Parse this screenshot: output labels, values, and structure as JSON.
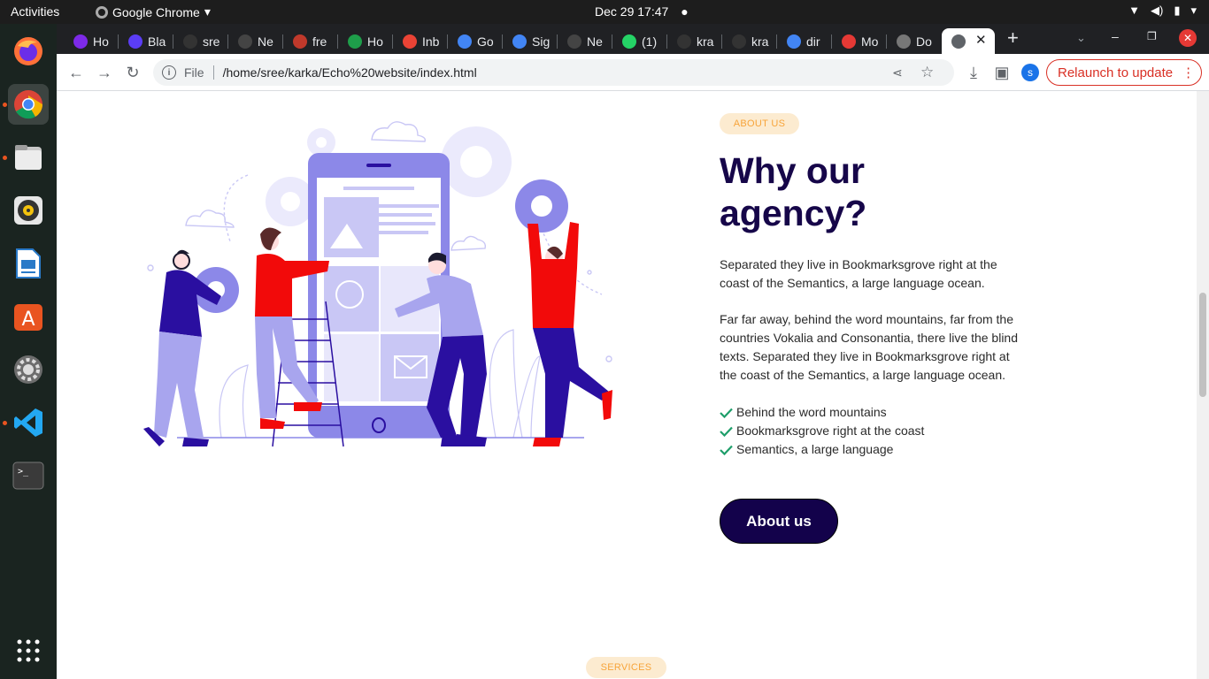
{
  "system": {
    "activities": "Activities",
    "app_name": "Google Chrome",
    "clock": "Dec 29  17:47"
  },
  "dock": {
    "items": [
      "firefox-icon",
      "chrome-icon",
      "files-icon",
      "rhythmbox-icon",
      "writer-icon",
      "software-icon",
      "settings-icon",
      "vscode-icon",
      "terminal-icon",
      "apps-grid-icon"
    ]
  },
  "tabs": [
    {
      "label": "Ho",
      "icon": "canva-icon",
      "color": "#7d2ae8"
    },
    {
      "label": "Bla",
      "icon": "blackbox-icon",
      "color": "#5b3df5"
    },
    {
      "label": "sre",
      "icon": "github-icon",
      "color": "#333333"
    },
    {
      "label": "Ne",
      "icon": "chrome-new-tab-icon",
      "color": "#444444"
    },
    {
      "label": "fre",
      "icon": "site-icon",
      "color": "#c0392b"
    },
    {
      "label": "Ho",
      "icon": "faq-icon",
      "color": "#1e9e4a"
    },
    {
      "label": "Inb",
      "icon": "gmail-icon",
      "color": "#ea4335"
    },
    {
      "label": "Go",
      "icon": "google-icon",
      "color": "#4285f4"
    },
    {
      "label": "Sig",
      "icon": "google-icon",
      "color": "#4285f4"
    },
    {
      "label": "Ne",
      "icon": "chrome-new-tab-icon",
      "color": "#444444"
    },
    {
      "label": "(1)",
      "icon": "whatsapp-icon",
      "color": "#25d366"
    },
    {
      "label": "kra",
      "icon": "github-icon",
      "color": "#333333"
    },
    {
      "label": "kra",
      "icon": "github-icon",
      "color": "#333333"
    },
    {
      "label": "dir",
      "icon": "google-icon",
      "color": "#4285f4"
    },
    {
      "label": "Mo",
      "icon": "my-icon",
      "color": "#e53935"
    },
    {
      "label": "Do",
      "icon": "globe-icon",
      "color": "#777777"
    },
    {
      "label": "",
      "icon": "globe-icon",
      "color": "#5f6368"
    }
  ],
  "toolbar": {
    "url_protocol": "File",
    "url": "/home/sree/karka/Echo%20website/index.html",
    "profile_initial": "s",
    "relaunch_label": "Relaunch to update"
  },
  "page": {
    "about_badge": "ABOUT US",
    "heading": "Why our agency?",
    "para1": "Separated they live in Bookmarksgrove right at the coast of the Semantics, a large language ocean.",
    "para2": "Far far away, behind the word mountains, far from the countries Vokalia and Consonantia, there live the blind texts. Separated they live in Bookmarksgrove right at the coast of the Semantics, a large language ocean.",
    "checklist": [
      "Behind the word mountains",
      "Bookmarksgrove right at the coast",
      "Semantics, a large language"
    ],
    "about_button": "About us",
    "services_badge": "SERVICES"
  },
  "colors": {
    "heading": "#160649",
    "badge_bg": "#fcebd0",
    "badge_text": "#f7a43a",
    "check": "#1e9e6a",
    "button_bg": "#13024b",
    "illus_purple": "#8c88e8",
    "illus_red": "#f20a0a",
    "illus_navy": "#2a0fa0"
  }
}
